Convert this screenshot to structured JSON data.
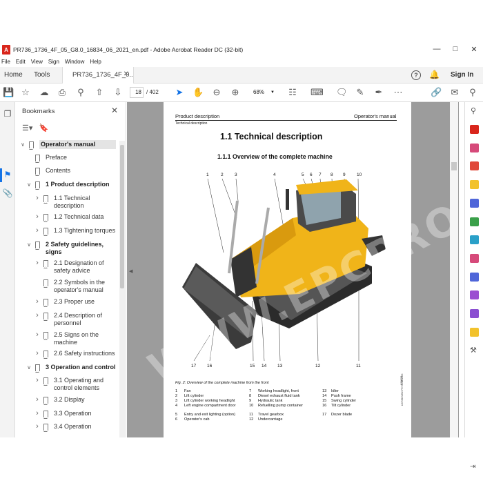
{
  "window": {
    "title": "PR736_1736_4F_05_G8.0_16834_06_2021_en.pdf - Adobe Acrobat Reader DC (32-bit)",
    "app_icon": "acrobat-icon",
    "menu": [
      "File",
      "Edit",
      "View",
      "Sign",
      "Window",
      "Help"
    ]
  },
  "tabs": {
    "home": "Home",
    "tools": "Tools",
    "doc": "PR736_1736_4F_0...",
    "sign_in": "Sign In"
  },
  "toolbar": {
    "page_current": "18",
    "page_total": "/ 402",
    "zoom": "68%"
  },
  "bookmarks": {
    "title": "Bookmarks",
    "items": [
      {
        "label": "Operator's manual",
        "level": 0,
        "bold": true,
        "caret": "down",
        "selected": true
      },
      {
        "label": "Preface",
        "level": 1
      },
      {
        "label": "Contents",
        "level": 1
      },
      {
        "label": "1 Product description",
        "level": 1,
        "bold": true,
        "caret": "down"
      },
      {
        "label": "1.1 Technical description",
        "level": 2,
        "caret": "right"
      },
      {
        "label": "1.2 Technical data",
        "level": 2,
        "caret": "right"
      },
      {
        "label": "1.3 Tightening torques",
        "level": 2,
        "caret": "right"
      },
      {
        "label": "2 Safety guidelines, signs",
        "level": 1,
        "bold": true,
        "caret": "down"
      },
      {
        "label": "2.1 Designation of safety advice",
        "level": 2,
        "caret": "right"
      },
      {
        "label": "2.2 Symbols in the operator's manual",
        "level": 2
      },
      {
        "label": "2.3 Proper use",
        "level": 2,
        "caret": "right"
      },
      {
        "label": "2.4 Description of personnel",
        "level": 2,
        "caret": "right"
      },
      {
        "label": "2.5 Signs on the machine",
        "level": 2,
        "caret": "right"
      },
      {
        "label": "2.6 Safety instructions",
        "level": 2,
        "caret": "right"
      },
      {
        "label": "3 Operation and control",
        "level": 1,
        "bold": true,
        "caret": "down"
      },
      {
        "label": "3.1 Operating and control elements",
        "level": 2,
        "caret": "right"
      },
      {
        "label": "3.2 Display",
        "level": 2,
        "caret": "right"
      },
      {
        "label": "3.3 Operation",
        "level": 2,
        "caret": "right"
      },
      {
        "label": "3.4 Operation",
        "level": 2,
        "caret": "right"
      }
    ]
  },
  "page": {
    "header_left": "Product description",
    "header_right": "Operator's manual",
    "header_sub": "Technical description",
    "heading1": "1.1   Technical description",
    "heading2": "1.1.1   Overview of the complete machine",
    "figure_numbers_top": [
      "1",
      "2",
      "3",
      "4",
      "5",
      "6",
      "7",
      "8",
      "9",
      "10"
    ],
    "figure_numbers_bottom": [
      "17",
      "16",
      "15",
      "14",
      "13",
      "12",
      "11"
    ],
    "side_code": "618033",
    "side_code2": "LWT/EDV/BZ-PR736-DE2006",
    "caption": "Fig. 2: Overview of the complete machine from the front",
    "legend": [
      {
        "n": "1",
        "t": "Fan"
      },
      {
        "n": "2",
        "t": "Lift cylinder"
      },
      {
        "n": "3",
        "t": "Lift cylinder working headlight"
      },
      {
        "n": "4",
        "t": "Left engine compartment door"
      },
      {
        "n": "5",
        "t": "Entry and exit lighting (option)"
      },
      {
        "n": "6",
        "t": "Operator's cab"
      },
      {
        "n": "7",
        "t": "Working headlight, front"
      },
      {
        "n": "8",
        "t": "Diesel exhaust fluid tank"
      },
      {
        "n": "9",
        "t": "Hydraulic tank"
      },
      {
        "n": "10",
        "t": "Refuelling pump container"
      },
      {
        "n": "11",
        "t": "Travel gearbox"
      },
      {
        "n": "12",
        "t": "Undercarriage"
      },
      {
        "n": "13",
        "t": "Idler"
      },
      {
        "n": "14",
        "t": "Push frame"
      },
      {
        "n": "15",
        "t": "Swing cylinder"
      },
      {
        "n": "16",
        "t": "Tilt cylinder"
      },
      {
        "n": "17",
        "t": "Dozer blade"
      }
    ]
  },
  "watermark": "WWW.EPCPRO.COM",
  "colors": {
    "accent": "#1473e6",
    "machine_yellow": "#f0b419",
    "pdf_bg": "#9c9c9c"
  }
}
